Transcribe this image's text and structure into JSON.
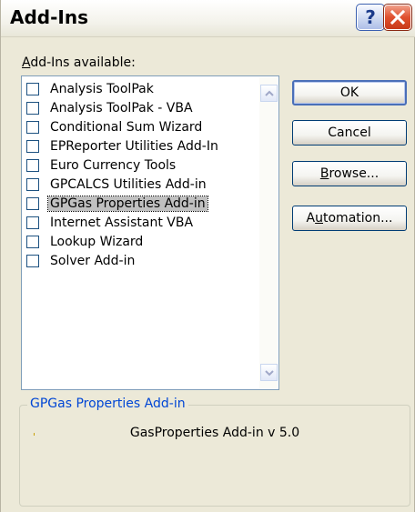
{
  "window": {
    "title": "Add-Ins",
    "help_glyph": "?",
    "close_icon": "close-icon"
  },
  "list": {
    "label_prefix": "A",
    "label_rest": "dd-Ins available:",
    "items": [
      {
        "label": "Analysis ToolPak",
        "checked": false
      },
      {
        "label": "Analysis ToolPak - VBA",
        "checked": false
      },
      {
        "label": "Conditional Sum Wizard",
        "checked": false
      },
      {
        "label": "EPReporter Utilities Add-In",
        "checked": false
      },
      {
        "label": "Euro Currency Tools",
        "checked": false
      },
      {
        "label": "GPCALCS Utilities Add-in",
        "checked": false
      },
      {
        "label": "GPGas Properties Add-in",
        "checked": false,
        "selected": true
      },
      {
        "label": "Internet Assistant VBA",
        "checked": false
      },
      {
        "label": "Lookup Wizard",
        "checked": false
      },
      {
        "label": "Solver Add-in",
        "checked": false
      }
    ]
  },
  "buttons": {
    "ok": "OK",
    "cancel": "Cancel",
    "browse_prefix": "B",
    "browse_rest": "rowse...",
    "automation_prefix": "A",
    "automation_u": "u",
    "automation_rest": "tomation..."
  },
  "details": {
    "title": "GPGas Properties Add-in",
    "description": "GasProperties Add-in v 5.0"
  },
  "colors": {
    "dialog_bg": "#ece9d8",
    "group_title": "#0046d5",
    "close_red": "#e0502e"
  }
}
